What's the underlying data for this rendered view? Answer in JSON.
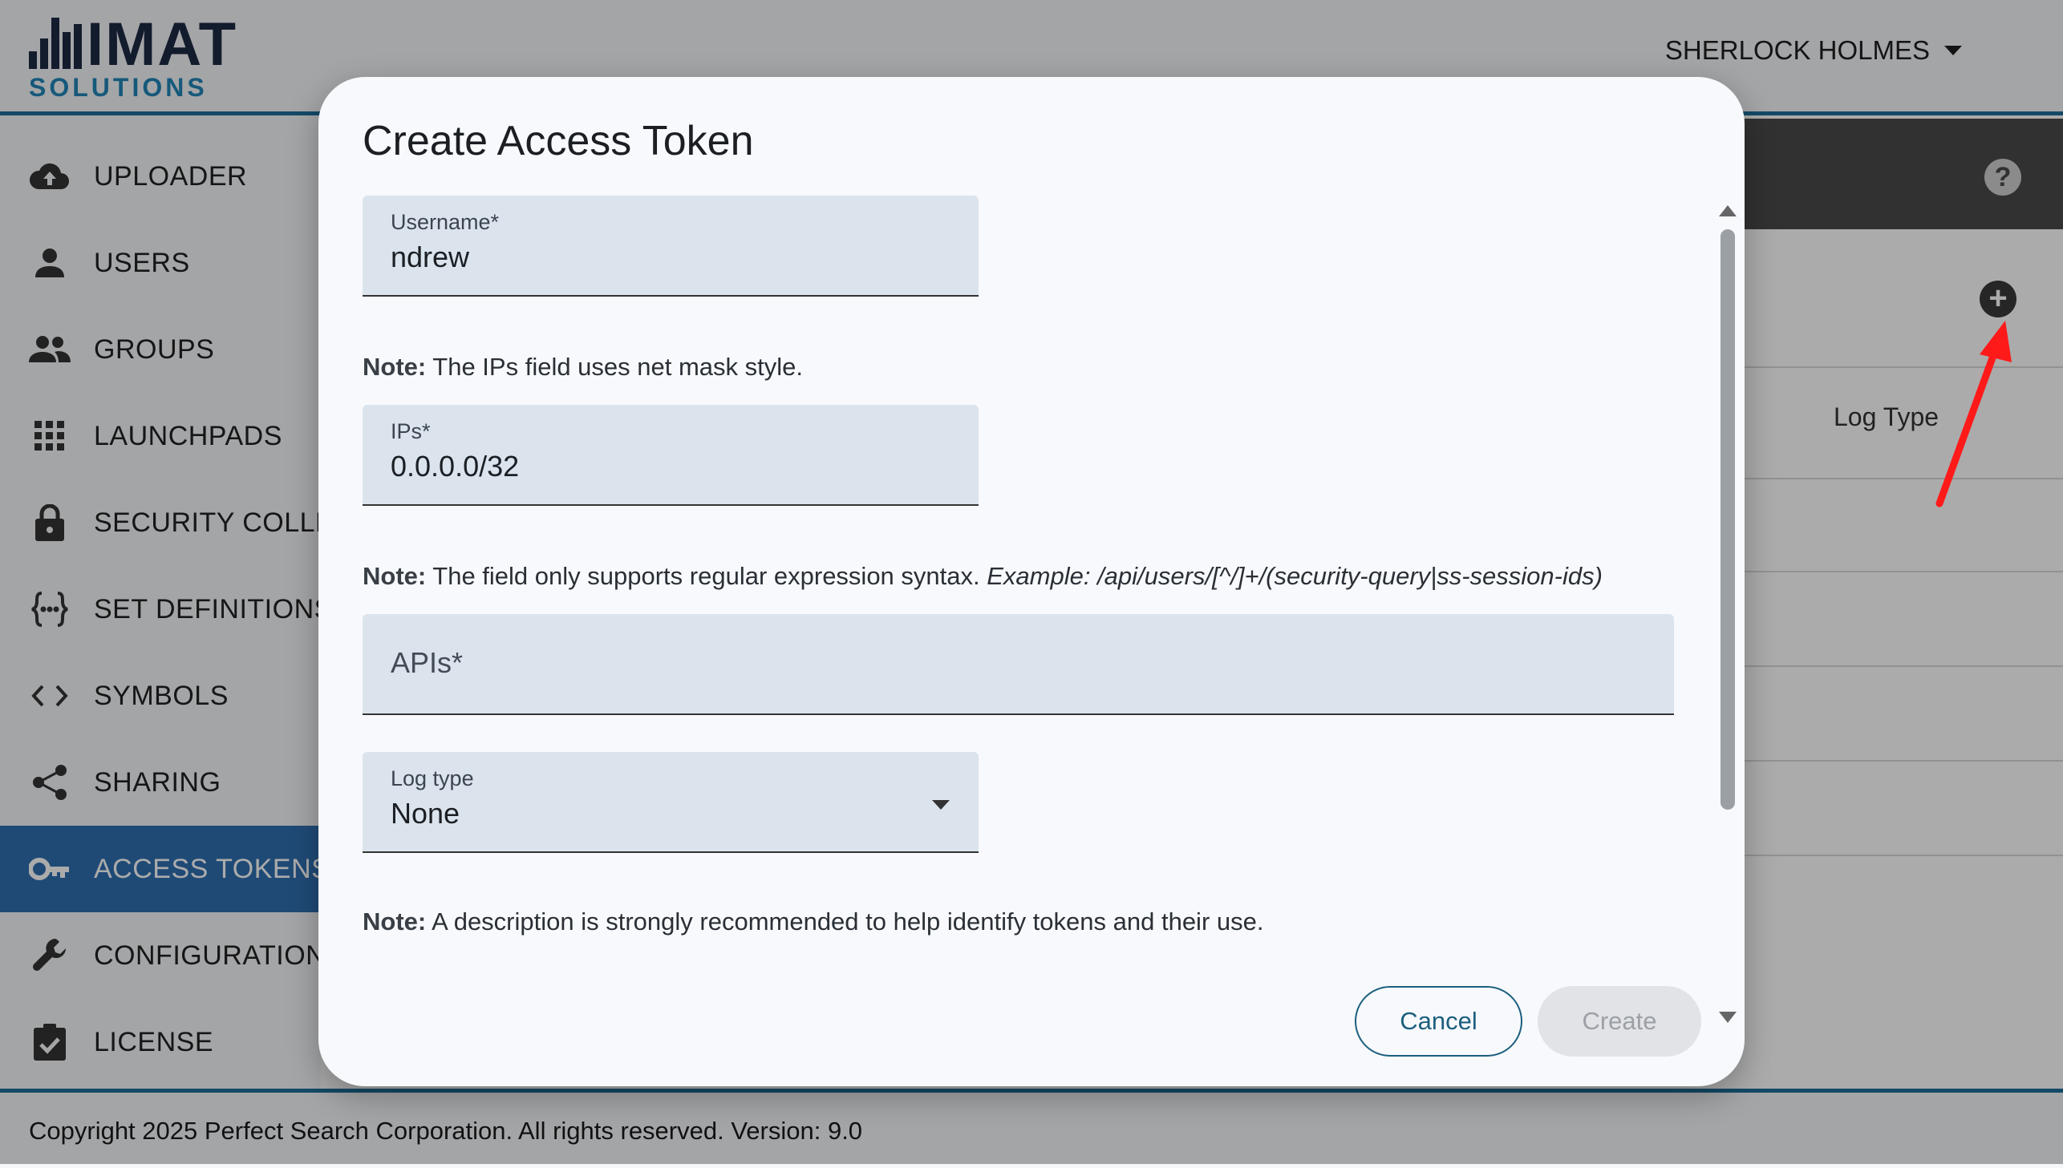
{
  "app": {
    "logo_main": "IMAT",
    "logo_sub": "SOLUTIONS",
    "user_name": "SHERLOCK HOLMES"
  },
  "sidebar": {
    "items": [
      {
        "label": "UPLOADER",
        "icon": "cloud-upload-icon"
      },
      {
        "label": "USERS",
        "icon": "person-icon"
      },
      {
        "label": "GROUPS",
        "icon": "people-icon"
      },
      {
        "label": "LAUNCHPADS",
        "icon": "grid-icon"
      },
      {
        "label": "SECURITY COLLE",
        "icon": "lock-icon"
      },
      {
        "label": "SET DEFINITIONS",
        "icon": "braces-icon"
      },
      {
        "label": "SYMBOLS",
        "icon": "code-icon"
      },
      {
        "label": "SHARING",
        "icon": "share-icon"
      },
      {
        "label": "ACCESS TOKENS",
        "icon": "key-icon",
        "active": true
      },
      {
        "label": "CONFIGURATION",
        "icon": "wrench-icon"
      },
      {
        "label": "LICENSE",
        "icon": "clipboard-check-icon"
      }
    ]
  },
  "content": {
    "column_header": "Log Type"
  },
  "footer": {
    "text": "Copyright 2025 Perfect Search Corporation. All rights reserved. Version: 9.0"
  },
  "dialog": {
    "title": "Create Access Token",
    "username": {
      "label": "Username*",
      "value": "ndrew"
    },
    "note_ips": {
      "bold": "Note:",
      "text": " The IPs field uses net mask style."
    },
    "ips": {
      "label": "IPs*",
      "value": "0.0.0.0/32"
    },
    "note_apis": {
      "bold": "Note:",
      "text": " The field only supports regular expression syntax. ",
      "example": "Example: /api/users/[^/]+/(security-query|ss-session-ids)"
    },
    "apis": {
      "placeholder": "APIs*",
      "value": ""
    },
    "log_type": {
      "label": "Log type",
      "value": "None"
    },
    "note_description": {
      "bold": "Note:",
      "text": " A description is strongly recommended to help identify tokens and their use."
    },
    "cancel_label": "Cancel",
    "create_label": "Create"
  },
  "colors": {
    "accent": "#1f6f9a",
    "active_nav": "#2f6fb0",
    "field_bg": "#dbe4ed",
    "annotation": "#ff1a1a"
  }
}
